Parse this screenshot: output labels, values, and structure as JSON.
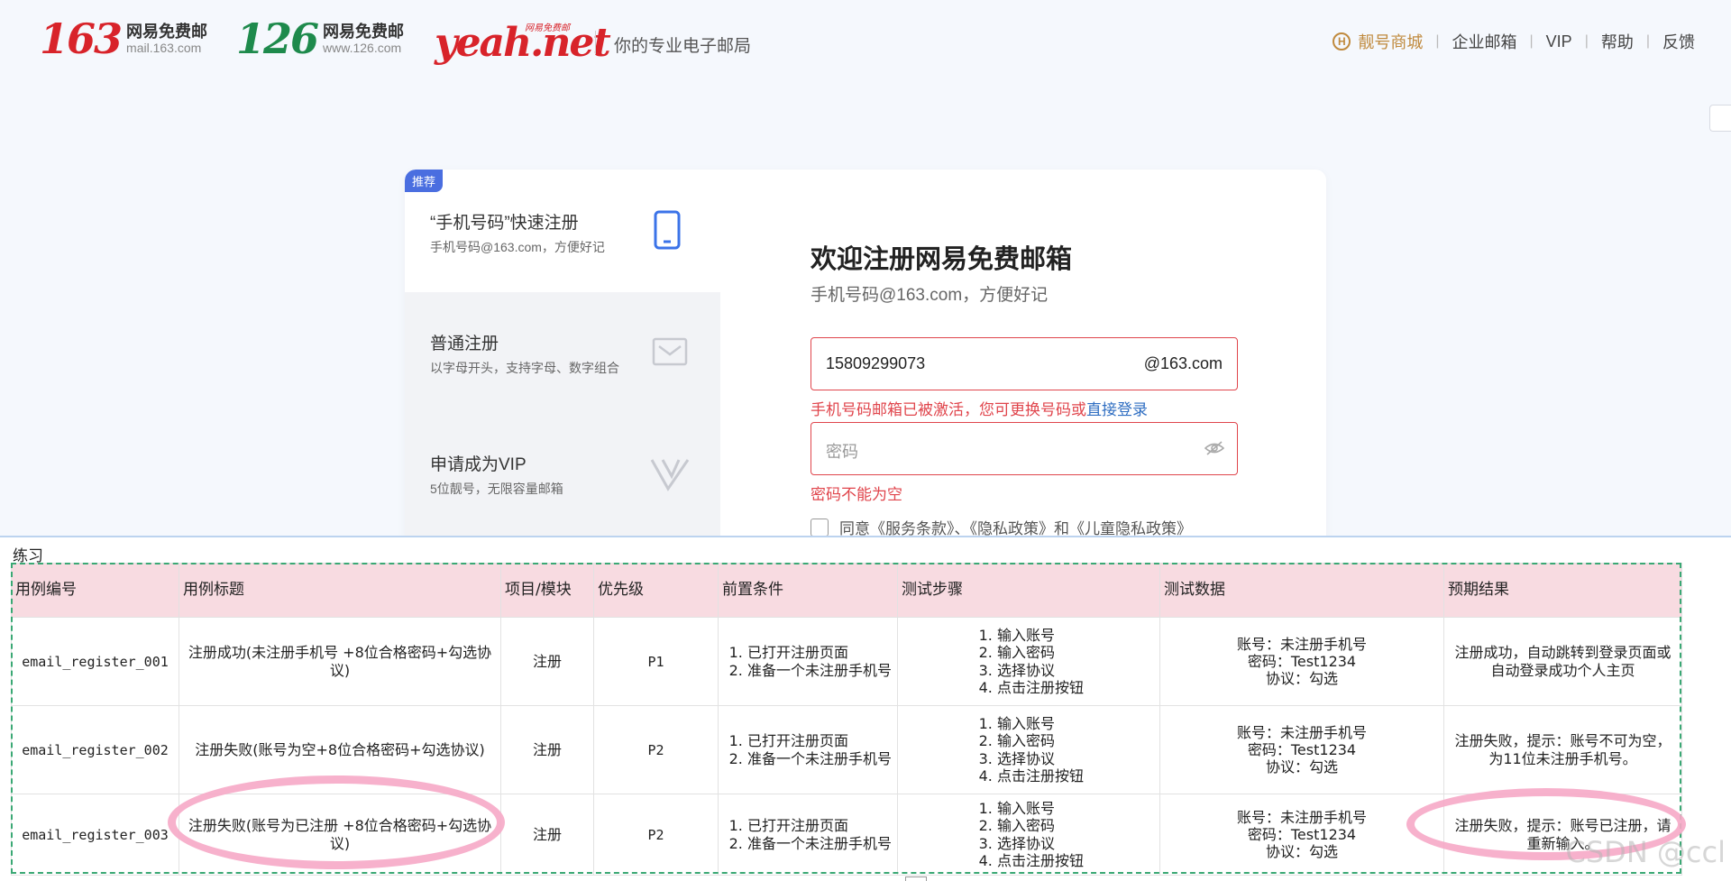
{
  "header": {
    "logo163": {
      "num": "163",
      "name": "网易免费邮",
      "domain": "mail.163.com"
    },
    "logo126": {
      "num": "126",
      "name": "网易免费邮",
      "domain": "www.126.com"
    },
    "yeah": {
      "text": "yeah.net",
      "mini": "网易免费邮"
    },
    "slogan": "你的专业电子邮局",
    "nav": {
      "shop": "靓号商城",
      "enterprise": "企业邮箱",
      "vip": "VIP",
      "help": "帮助",
      "feedback": "反馈",
      "sep": "|"
    }
  },
  "tabs": {
    "badge": "推荐",
    "phone": {
      "title": "“手机号码”快速注册",
      "sub": "手机号码@163.com，方便好记"
    },
    "normal": {
      "title": "普通注册",
      "sub": "以字母开头，支持字母、数字组合"
    },
    "vip": {
      "title": "申请成为VIP",
      "sub": "5位靓号，无限容量邮箱"
    }
  },
  "form": {
    "title": "欢迎注册网易免费邮箱",
    "subtitle": "手机号码@163.com，方便好记",
    "phone_value": "15809299073",
    "phone_suffix": "@163.com",
    "phone_error": "手机号码邮箱已被激活，您可更换号码或",
    "phone_error_link": "直接登录",
    "password_placeholder": "密码",
    "password_error": "密码不能为空",
    "agree_text": "同意《服务条款》、《隐私政策》和《儿童隐私政策》"
  },
  "sheet": {
    "title": "练习",
    "headers": [
      "用例编号",
      "用例标题",
      "项目/模块",
      "优先级",
      "前置条件",
      "测试步骤",
      "测试数据",
      "预期结果"
    ],
    "rows": [
      {
        "id": "email_register_001",
        "title": "注册成功(未注册手机号 +8位合格密码+勾选协议)",
        "module": "注册",
        "priority": "P1",
        "pre": [
          "已打开注册页面",
          "准备一个未注册手机号"
        ],
        "steps": [
          "输入账号",
          "输入密码",
          "选择协议",
          "点击注册按钮"
        ],
        "data": [
          "账号：未注册手机号",
          "密码：Test1234",
          "协议：勾选"
        ],
        "expected": "注册成功，自动跳转到登录页面或自动登录成功个人主页"
      },
      {
        "id": "email_register_002",
        "title": "注册失败(账号为空+8位合格密码+勾选协议)",
        "module": "注册",
        "priority": "P2",
        "pre": [
          "已打开注册页面",
          "准备一个未注册手机号"
        ],
        "steps": [
          "输入账号",
          "输入密码",
          "选择协议",
          "点击注册按钮"
        ],
        "data": [
          "账号：未注册手机号",
          "密码：Test1234",
          "协议：勾选"
        ],
        "expected": "注册失败，提示：账号不可为空，为11位未注册手机号。"
      },
      {
        "id": "email_register_003",
        "title": "注册失败(账号为已注册 +8位合格密码+勾选协议)",
        "module": "注册",
        "priority": "P2",
        "pre": [
          "已打开注册页面",
          "准备一个未注册手机号"
        ],
        "steps": [
          "输入账号",
          "输入密码",
          "选择协议",
          "点击注册按钮"
        ],
        "data": [
          "账号：未注册手机号",
          "密码：Test1234",
          "协议：勾选"
        ],
        "expected": "注册失败，提示：账号已注册，请重新输入。"
      }
    ],
    "watermark": "CSDN @ccl"
  },
  "colors": {
    "brand_red": "#d8232a",
    "brand_green": "#1e8a4c",
    "accent_blue": "#4a6ee0",
    "error": "#e0454c",
    "header_pink": "#f8dbe1",
    "highlight": "#f6a8c6"
  }
}
